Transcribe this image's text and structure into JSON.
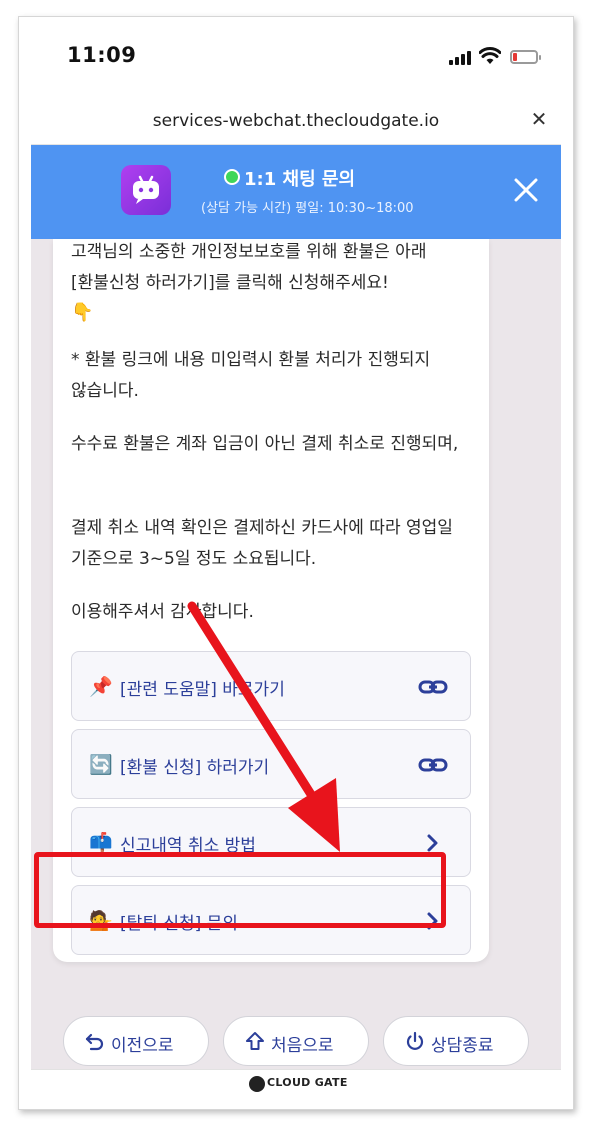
{
  "status_bar": {
    "time": "11:09"
  },
  "browser": {
    "url": "services-webchat.thecloudgate.io"
  },
  "chat_header": {
    "title": "1:1 채팅 문의",
    "subtitle": "(상담 가능 시간) 평일: 10:30~18:00"
  },
  "message": {
    "line1": "고객님의 소중한 개인정보보호를 위해 환불은 아래 [환불신청 하러가기]를 클릭해 신청해주세요!",
    "point_emoji": "👇",
    "para2": "* 환불 링크에 내용 미입력시 환불 처리가 진행되지 않습니다.",
    "para3": "수수료 환불은 계좌 입금이 아닌 결제 취소로 진행되며,",
    "para4": "결제 취소 내역 확인은 결제하신 카드사에 따라 영업일 기준으로 3~5일 정도 소요됩니다.",
    "para5": "이용해주셔서 감사합니다."
  },
  "buttons": [
    {
      "emoji": "📌",
      "label": "[관련 도움말] 바로가기",
      "trail": "link-icon"
    },
    {
      "emoji": "🔄",
      "label": "[환불 신청] 하러가기",
      "trail": "link-icon"
    },
    {
      "emoji": "📫",
      "label": "신고내역 취소 방법",
      "trail": "chevron-right-icon"
    },
    {
      "emoji": "💁",
      "label": "[탈퇴 신청] 문의",
      "trail": "chevron-right-icon"
    }
  ],
  "actions": {
    "prev": "이전으로",
    "home": "처음으로",
    "end": "상담종료"
  },
  "footer": {
    "brand": "CLOUD GATE"
  },
  "colors": {
    "header_bg": "#4f94f2",
    "link_text": "#2c3f9a",
    "highlight": "#e8141c",
    "online_dot": "#3fd65a"
  }
}
